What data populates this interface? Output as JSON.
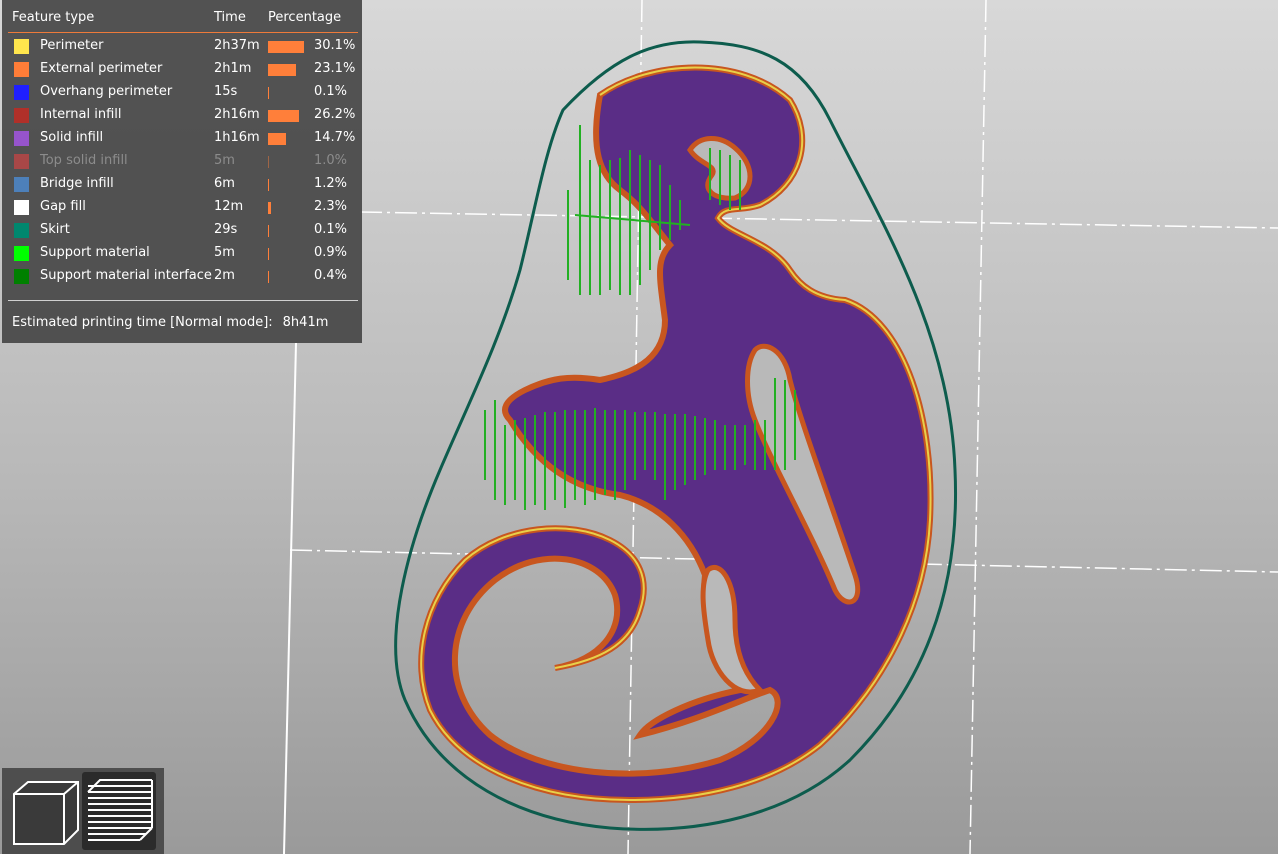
{
  "legend": {
    "headers": {
      "feature": "Feature type",
      "time": "Time",
      "percentage": "Percentage"
    },
    "rows": [
      {
        "name": "Perimeter",
        "time": "2h37m",
        "pct": "30.1%",
        "fraction": 0.301,
        "color": "#ffe64d",
        "dim": false
      },
      {
        "name": "External perimeter",
        "time": "2h1m",
        "pct": "23.1%",
        "fraction": 0.231,
        "color": "#ff7d38",
        "dim": false
      },
      {
        "name": "Overhang perimeter",
        "time": "15s",
        "pct": "0.1%",
        "fraction": 0.001,
        "color": "#1f1fff",
        "dim": false
      },
      {
        "name": "Internal infill",
        "time": "2h16m",
        "pct": "26.2%",
        "fraction": 0.262,
        "color": "#b03029",
        "dim": false
      },
      {
        "name": "Solid infill",
        "time": "1h16m",
        "pct": "14.7%",
        "fraction": 0.147,
        "color": "#9654cc",
        "dim": false
      },
      {
        "name": "Top solid infill",
        "time": "5m",
        "pct": "1.0%",
        "fraction": 0.01,
        "color": "#f04040",
        "dim": true
      },
      {
        "name": "Bridge infill",
        "time": "6m",
        "pct": "1.2%",
        "fraction": 0.012,
        "color": "#4d80ba",
        "dim": false
      },
      {
        "name": "Gap fill",
        "time": "12m",
        "pct": "2.3%",
        "fraction": 0.023,
        "color": "#ffffff",
        "dim": false
      },
      {
        "name": "Skirt",
        "time": "29s",
        "pct": "0.1%",
        "fraction": 0.001,
        "color": "#00876e",
        "dim": false
      },
      {
        "name": "Support material",
        "time": "5m",
        "pct": "0.9%",
        "fraction": 0.009,
        "color": "#00ff00",
        "dim": false
      },
      {
        "name": "Support material interface",
        "time": "2m",
        "pct": "0.4%",
        "fraction": 0.004,
        "color": "#008000",
        "dim": false
      }
    ],
    "estimated_label": "Estimated printing time [Normal mode]:",
    "estimated_value": "8h41m"
  },
  "view_buttons": [
    {
      "name": "3d-view-button",
      "icon": "cube-icon"
    },
    {
      "name": "preview-button",
      "icon": "layers-icon"
    }
  ],
  "colors": {
    "skirt": "#0d5c4d",
    "external_perimeter": "#c8561f",
    "perimeter": "#e8d04a",
    "solid_infill": "#5a2d86",
    "support": "#22b022"
  }
}
